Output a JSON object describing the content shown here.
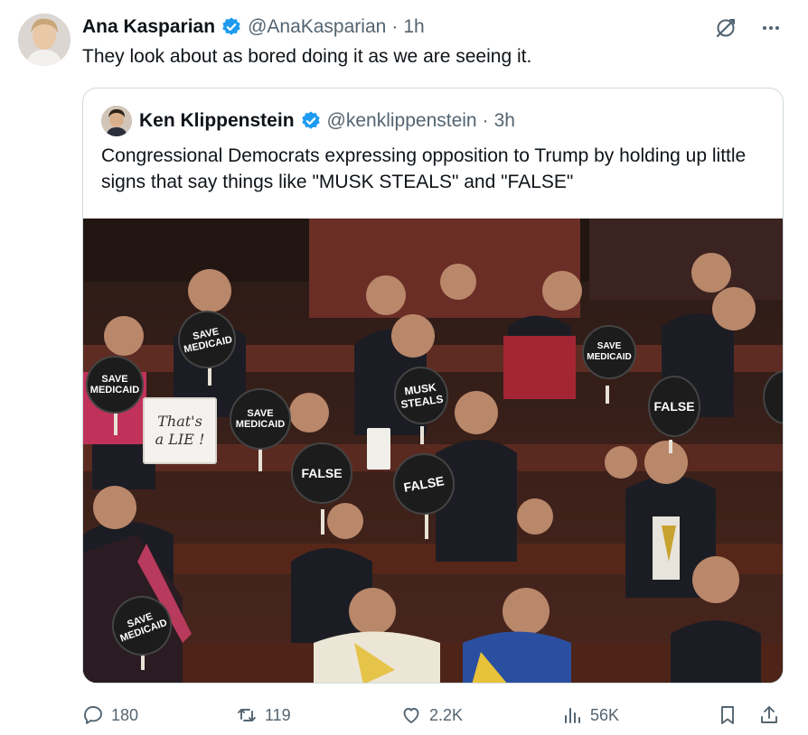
{
  "tweet": {
    "author_name": "Ana Kasparian",
    "handle": "@AnaKasparian",
    "separator": "·",
    "time": "1h",
    "text": "They look about as bored doing it as we are seeing it."
  },
  "quoted": {
    "author_name": "Ken Klippenstein",
    "handle": "@kenklippenstein",
    "separator": "·",
    "time": "3h",
    "text": "Congressional Democrats expressing opposition to Trump by holding up little signs that say things like \"MUSK STEALS\" and \"FALSE\"",
    "media": {
      "signs": [
        {
          "line1": "SAVE",
          "line2": "MEDICAID"
        },
        {
          "line1": "SAVE",
          "line2": "MEDICAID"
        },
        {
          "line1": "SAVE",
          "line2": "MEDICAID"
        },
        {
          "line1": "SAVE",
          "line2": "MEDICAID"
        },
        {
          "line1": "SAVE",
          "line2": "MEDICAID"
        },
        {
          "line1": "MUSK",
          "line2": "STEALS"
        },
        {
          "line1": "FALSE",
          "line2": ""
        },
        {
          "line1": "FALSE",
          "line2": ""
        },
        {
          "line1": "FALSE",
          "line2": ""
        }
      ],
      "paper_sign": {
        "line1": "That's",
        "line2": "a LIE !"
      }
    }
  },
  "actions": {
    "replies": "180",
    "reposts": "119",
    "likes": "2.2K",
    "views": "56K"
  },
  "colors": {
    "accent": "#1d9bf0",
    "secondary_text": "#536471",
    "border": "#cfd9de",
    "chamber": "#5a2a1f",
    "sign": "#1c1c1c"
  },
  "icons": {
    "verified": "verified-badge-icon",
    "grok": "grok-icon",
    "more": "more-icon",
    "reply": "reply-icon",
    "repost": "repost-icon",
    "like": "like-icon",
    "views": "views-icon",
    "bookmark": "bookmark-icon",
    "share": "share-icon"
  }
}
